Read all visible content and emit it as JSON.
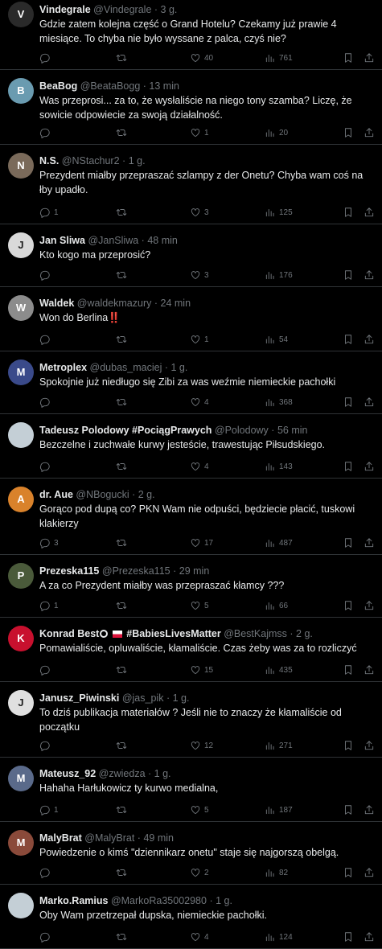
{
  "icons": {
    "reply": "reply-icon",
    "retweet": "retweet-icon",
    "like": "like-icon",
    "views": "views-icon",
    "bookmark": "bookmark-icon",
    "share": "share-icon"
  },
  "colors": {
    "background": "#000000",
    "divider": "#2f3336",
    "muted": "#71767b",
    "text": "#e7e9ea"
  },
  "tweets": [
    {
      "name": "Vindegrale",
      "handle": "@Vindegrale",
      "time": "3 g.",
      "text": "Gdzie zatem kolejna część o Grand Hotelu? Czekamy już prawie 4 miesiące. To chyba nie było wyssane z palca, czyś nie?",
      "replies": "",
      "retweets": "",
      "likes": "40",
      "views": "761",
      "avatar_color": "#2a2a2a",
      "avatar_initial": "V"
    },
    {
      "name": "BeaBog",
      "handle": "@BeataBogg",
      "time": "13 min",
      "text": "Was przeprosi... za to, że wysłaliście na niego tony szamba? Liczę, że sowicie odpowiecie za swoją działalność.",
      "replies": "",
      "retweets": "",
      "likes": "1",
      "views": "20",
      "avatar_color": "#6a9bb0",
      "avatar_initial": "B"
    },
    {
      "name": "N.S.",
      "handle": "@NStachur2",
      "time": "1 g.",
      "text": "Prezydent miałby przepraszać szlampy z der Onetu? Chyba wam coś na łby upadło.",
      "replies": "1",
      "retweets": "",
      "likes": "3",
      "views": "125",
      "avatar_color": "#7a6a5a",
      "avatar_initial": "N"
    },
    {
      "name": "Jan Sliwa",
      "handle": "@JanSliwa",
      "time": "48 min",
      "text": "Kto kogo ma przeprosić?",
      "replies": "",
      "retweets": "",
      "likes": "3",
      "views": "176",
      "avatar_color": "#d9d9d9",
      "avatar_initial": "J"
    },
    {
      "name": "Waldek",
      "handle": "@waldekmazury",
      "time": "24 min",
      "text": "Won do Berlina",
      "extra": "‼️",
      "replies": "",
      "retweets": "",
      "likes": "1",
      "views": "54",
      "avatar_color": "#8c8c8c",
      "avatar_initial": "W"
    },
    {
      "name": "Metroplex",
      "handle": "@dubas_maciej",
      "time": "1 g.",
      "text": "Spokojnie już niedługo się Zibi za was weźmie niemieckie pachołki",
      "replies": "",
      "retweets": "",
      "likes": "4",
      "views": "368",
      "avatar_color": "#3a4a8a",
      "avatar_initial": "M"
    },
    {
      "name": "Tadeusz Polodowy #PociągPrawych",
      "handle": "@Polodowy",
      "time": "56 min",
      "text": "Bezczelne i zuchwałe kurwy jesteście, trawestując Piłsudskiego.",
      "replies": "",
      "retweets": "",
      "likes": "4",
      "views": "143",
      "avatar_color": "#c4cfd6",
      "avatar_initial": ""
    },
    {
      "name": "dr. Aue",
      "handle": "@NBogucki",
      "time": "2 g.",
      "text": "Gorąco pod dupą co? PKN Wam nie odpuści, będziecie płacić, tuskowi klakierzy",
      "replies": "3",
      "retweets": "",
      "likes": "17",
      "views": "487",
      "avatar_color": "#d9822b",
      "avatar_initial": "A"
    },
    {
      "name": "Prezeska115",
      "handle": "@Prezeska115",
      "time": "29 min",
      "text": "A za co Prezydent miałby was przepraszać kłamcy ???",
      "replies": "1",
      "retweets": "",
      "likes": "5",
      "views": "66",
      "avatar_color": "#4a5a3a",
      "avatar_initial": "P"
    },
    {
      "name": "Konrad Best",
      "name_suffix": "#BabiesLivesMatter",
      "handle": "@BestKajmss",
      "time": "2 g.",
      "text": "Pomawialiście, opluwaliście, kłamaliście. Czas żeby was  za to rozliczyć",
      "replies": "",
      "retweets": "",
      "likes": "15",
      "views": "435",
      "avatar_color": "#c8102e",
      "avatar_initial": "K"
    },
    {
      "name": "Janusz_Piwinski",
      "handle": "@jas_pik",
      "time": "1 g.",
      "text": "To dziś publikacja materiałów ? Jeśli nie to znaczy że kłamaliście od początku",
      "replies": "",
      "retweets": "",
      "likes": "12",
      "views": "271",
      "avatar_color": "#e0e0e0",
      "avatar_initial": "J"
    },
    {
      "name": "Mateusz_92",
      "handle": "@zwiedza",
      "time": "1 g.",
      "text": "Hahaha Harłukowicz ty kurwo medialna,",
      "replies": "1",
      "retweets": "",
      "likes": "5",
      "views": "187",
      "avatar_color": "#5a6a8a",
      "avatar_initial": "M"
    },
    {
      "name": "MalyBrat",
      "handle": "@MalyBrat",
      "time": "49 min",
      "text": "Powiedzenie o kimś \"dziennikarz onetu\" staje się najgorszą obelgą.",
      "replies": "",
      "retweets": "",
      "likes": "2",
      "views": "82",
      "avatar_color": "#8a4a3a",
      "avatar_initial": "M"
    },
    {
      "name": "Marko.Ramius",
      "handle": "@MarkoRa35002980",
      "time": "1 g.",
      "text": "Oby Wam przetrzepał dupska, niemieckie pachołki.",
      "replies": "",
      "retweets": "",
      "likes": "4",
      "views": "124",
      "avatar_color": "#c4cfd6",
      "avatar_initial": ""
    }
  ]
}
